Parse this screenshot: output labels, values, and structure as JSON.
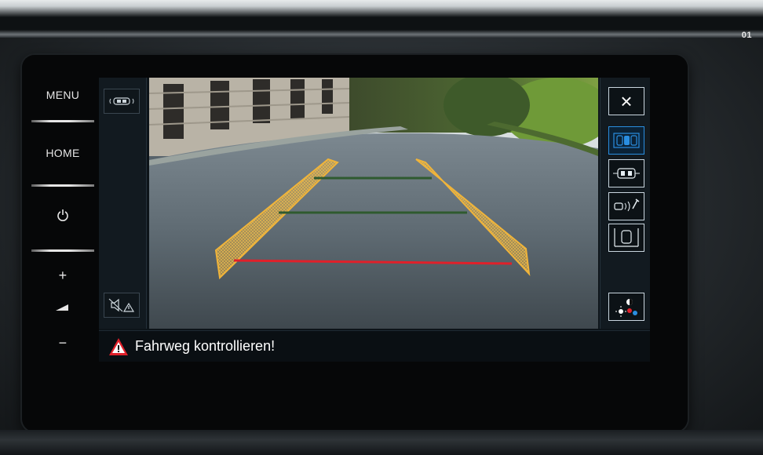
{
  "page_number": "01",
  "hardware_keys": {
    "menu_label": "MENU",
    "home_label": "HOME",
    "power_icon": "power-icon",
    "volume_up_label": "+",
    "volume_down_label": "−",
    "volume_icon": "volume-icon"
  },
  "screen": {
    "left_rail": {
      "top_icon": "car-sensors-icon",
      "bottom_icon": "mute-audio-warning-icon"
    },
    "right_rail": {
      "close_label": "×",
      "buttons": [
        {
          "icon": "park-view-all-icon",
          "active": true
        },
        {
          "icon": "car-top-view-icon",
          "active": false
        },
        {
          "icon": "rear-sensor-settings-icon",
          "active": false
        },
        {
          "icon": "parking-slot-icon",
          "active": false
        },
        {
          "icon": "display-settings-icon",
          "active": false
        }
      ]
    },
    "warning": {
      "icon": "warning-triangle-icon",
      "text": "Fahrweg kontrollieren!"
    },
    "colors": {
      "guide_yellow": "#f0b43a",
      "guide_red": "#e0202a",
      "guide_green": "#2f5a2f",
      "active_accent": "#2a8ee0"
    }
  }
}
